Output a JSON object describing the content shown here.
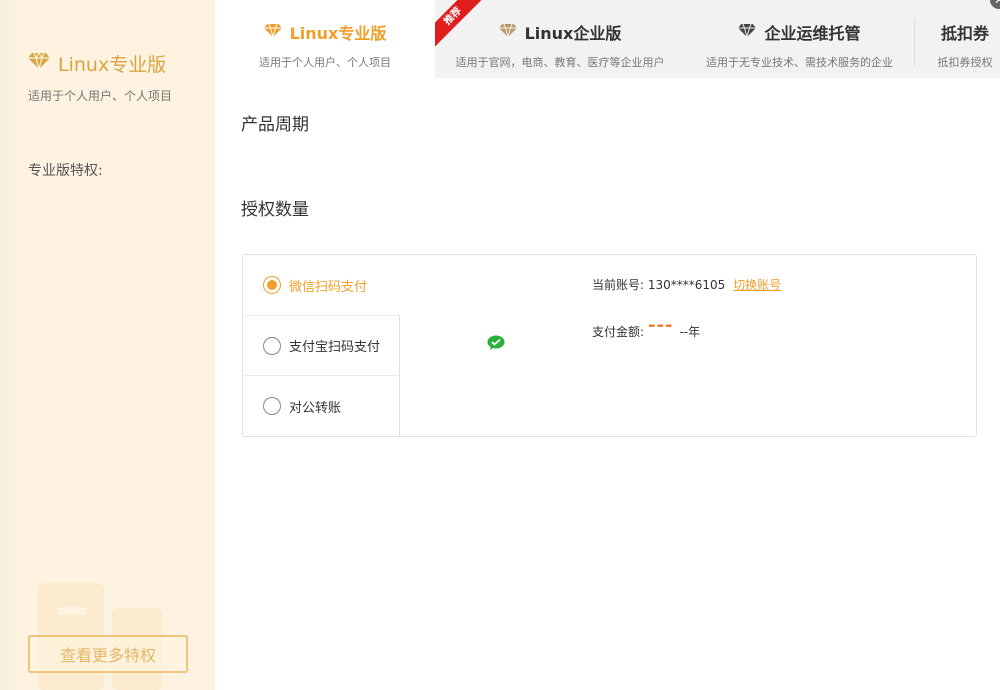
{
  "colors": {
    "accent": "#f0a02a",
    "ribbon": "#e01e1e",
    "left_bg": "#fdf3e0",
    "wechat": "#2aae3e"
  },
  "left_panel": {
    "icon": "diamond-icon",
    "title": "Linux专业版",
    "subtitle": "适用于个人用户、个人项目",
    "privileges_label": "专业版特权:",
    "more_button": "查看更多特权"
  },
  "tabs": [
    {
      "name": "Linux专业版",
      "desc": "适用于个人用户、个人项目",
      "icon": "diamond-icon",
      "active": true
    },
    {
      "name": "Linux企业版",
      "desc": "适用于官网，电商、教育、医疗等企业用户",
      "icon": "diamond-icon",
      "badge": "推荐"
    },
    {
      "name": "企业运维托管",
      "desc": "适用于无专业技术、需技术服务的企业",
      "icon": "diamond-icon"
    },
    {
      "name": "抵扣券",
      "desc": "抵扣券授权"
    }
  ],
  "main": {
    "product_cycle_label": "产品周期",
    "license_count_label": "授权数量"
  },
  "payment": {
    "options": [
      {
        "label": "微信扫码支付",
        "selected": true
      },
      {
        "label": "支付宝扫码支付",
        "selected": false
      },
      {
        "label": "对公转账",
        "selected": false
      }
    ],
    "account_label": "当前账号:",
    "account_value": "130****6105",
    "switch_account": "切换账号",
    "amount_label": "支付金额:",
    "amount_value": "---",
    "amount_unit": "--年"
  }
}
